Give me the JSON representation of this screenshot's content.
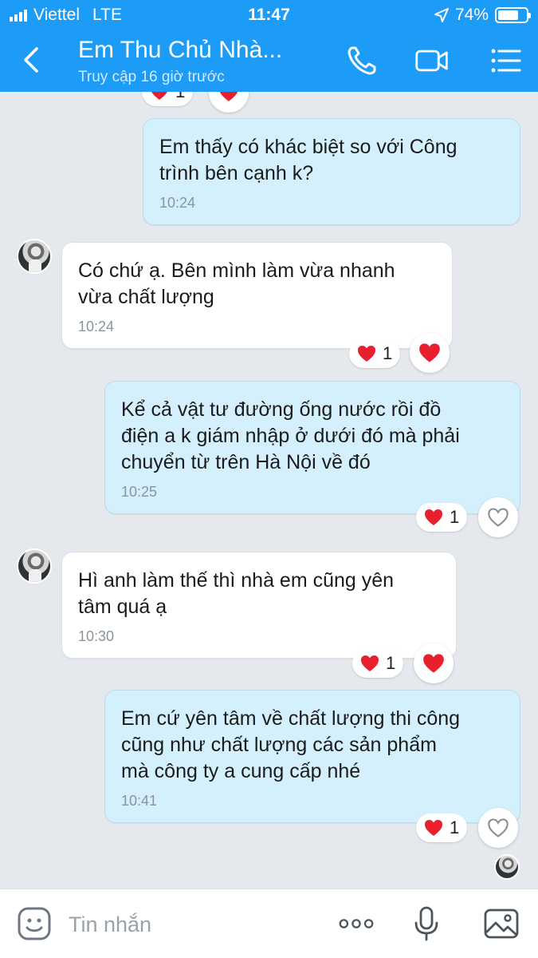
{
  "status": {
    "carrier": "Viettel",
    "network": "LTE",
    "time": "11:47",
    "battery_percent": "74%",
    "battery_level": 0.74
  },
  "header": {
    "contact_name": "Em Thu Chủ Nhà...",
    "last_seen": "Truy cập 16 giờ trước"
  },
  "messages": [
    {
      "direction": "out",
      "lines": [
        "Em thấy có khác biệt so với Công",
        "trình bên cạnh k?"
      ],
      "time": "10:24"
    },
    {
      "direction": "in",
      "lines": [
        "Có chứ ạ. Bên mình làm vừa nhanh",
        "vừa chất lượng"
      ],
      "time": "10:24",
      "reaction_count": "1"
    },
    {
      "direction": "out",
      "lines": [
        "Kể cả vật tư đường ống nước rồi đồ",
        "điện a k giám nhập ở dưới đó mà phải",
        "chuyển từ trên Hà Nội về đó"
      ],
      "time": "10:25",
      "reaction_count": "1"
    },
    {
      "direction": "in",
      "lines": [
        "Hì anh làm thế thì nhà em cũng yên",
        "tâm quá ạ"
      ],
      "time": "10:30",
      "reaction_count": "1"
    },
    {
      "direction": "out",
      "lines": [
        "Em cứ yên tâm về chất lượng thi công",
        "cũng như chất lượng các sản phẩm",
        "mà công ty a cung cấp nhé"
      ],
      "time": "10:41",
      "reaction_count": "1"
    }
  ],
  "top_partial_reaction_count": "1",
  "input": {
    "placeholder": "Tin nhắn",
    "value": ""
  },
  "icons": {
    "back": "chevron-left-icon",
    "call": "phone-icon",
    "video": "video-camera-icon",
    "menu": "list-menu-icon",
    "sticker": "sticker-smile-icon",
    "more": "more-dots-icon",
    "voice": "microphone-icon",
    "image": "image-gallery-icon"
  },
  "colors": {
    "header": "#1c9cf6",
    "background": "#e5e9ee",
    "outgoing_bubble": "#d5f0fd",
    "incoming_bubble": "#ffffff",
    "heart": "#e8202e"
  }
}
